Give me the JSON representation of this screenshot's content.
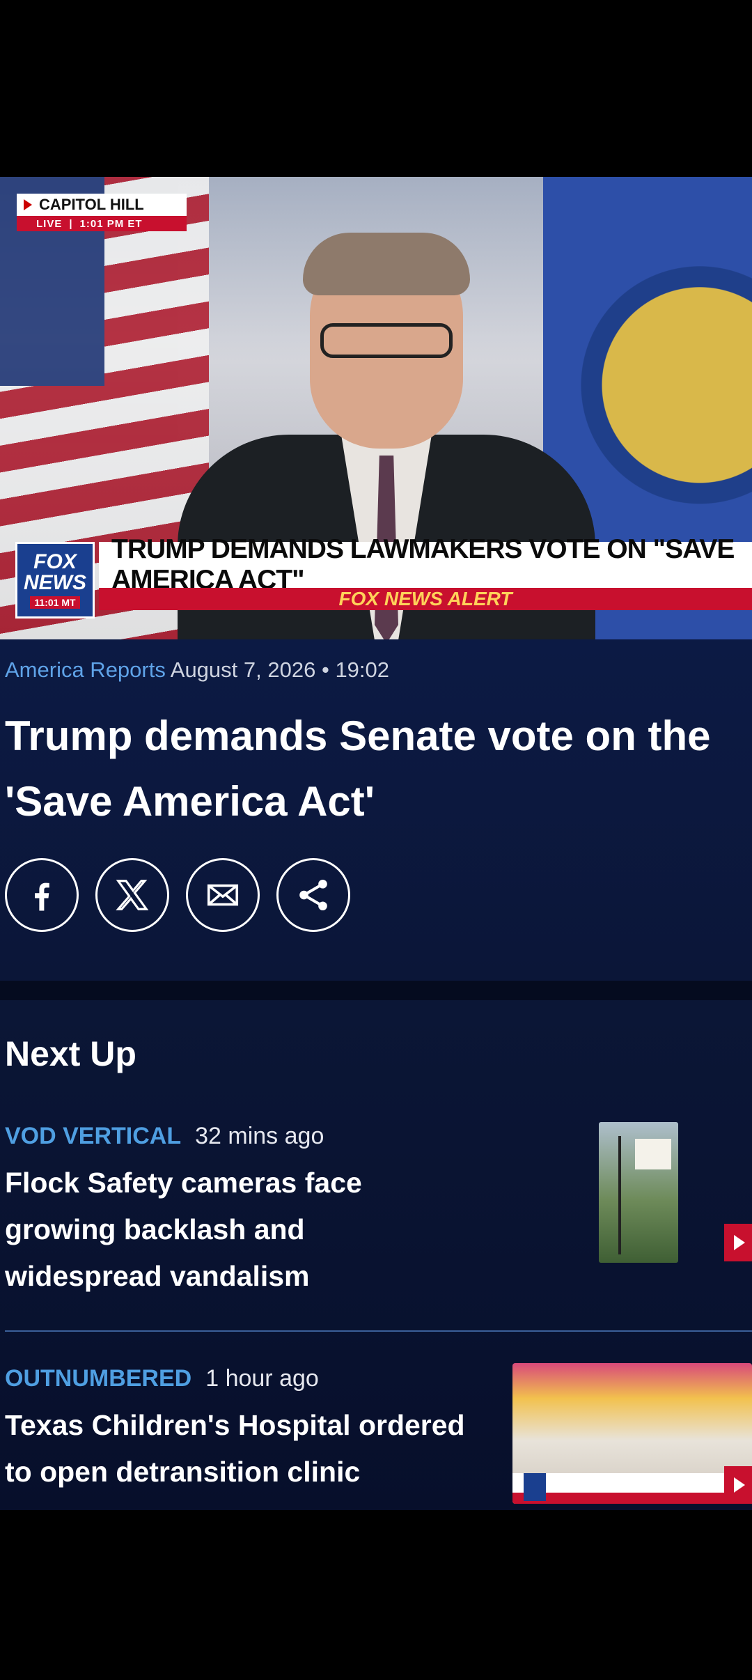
{
  "video": {
    "live_bug": {
      "location": "CAPITOL HILL",
      "live": "LIVE",
      "time": "1:01 PM ET"
    },
    "logo": {
      "line1": "FOX",
      "line2": "NEWS",
      "time": "11:01 MT"
    },
    "chyron_headline": "TRUMP DEMANDS LAWMAKERS VOTE ON \"SAVE AMERICA ACT\"",
    "alert": "FOX NEWS ALERT"
  },
  "article": {
    "show": "America Reports",
    "date": "August 7, 2026",
    "separator": "•",
    "time": "19:02",
    "title": "Trump demands Senate vote on the 'Save America Act'",
    "share_icons": [
      "facebook-icon",
      "x-icon",
      "email-icon",
      "share-icon"
    ]
  },
  "next_up": {
    "heading": "Next Up",
    "items": [
      {
        "show": "VOD VERTICAL",
        "time": "32 mins ago",
        "headline": "Flock Safety cameras face growing backlash and widespread vandalism"
      },
      {
        "show": "OUTNUMBERED",
        "time": "1 hour ago",
        "headline": "Texas Children's Hospital ordered to open detransition clinic"
      }
    ]
  },
  "colors": {
    "background": "#0b1638",
    "accent_blue": "#4f9fe2",
    "fox_red": "#c8102e"
  }
}
